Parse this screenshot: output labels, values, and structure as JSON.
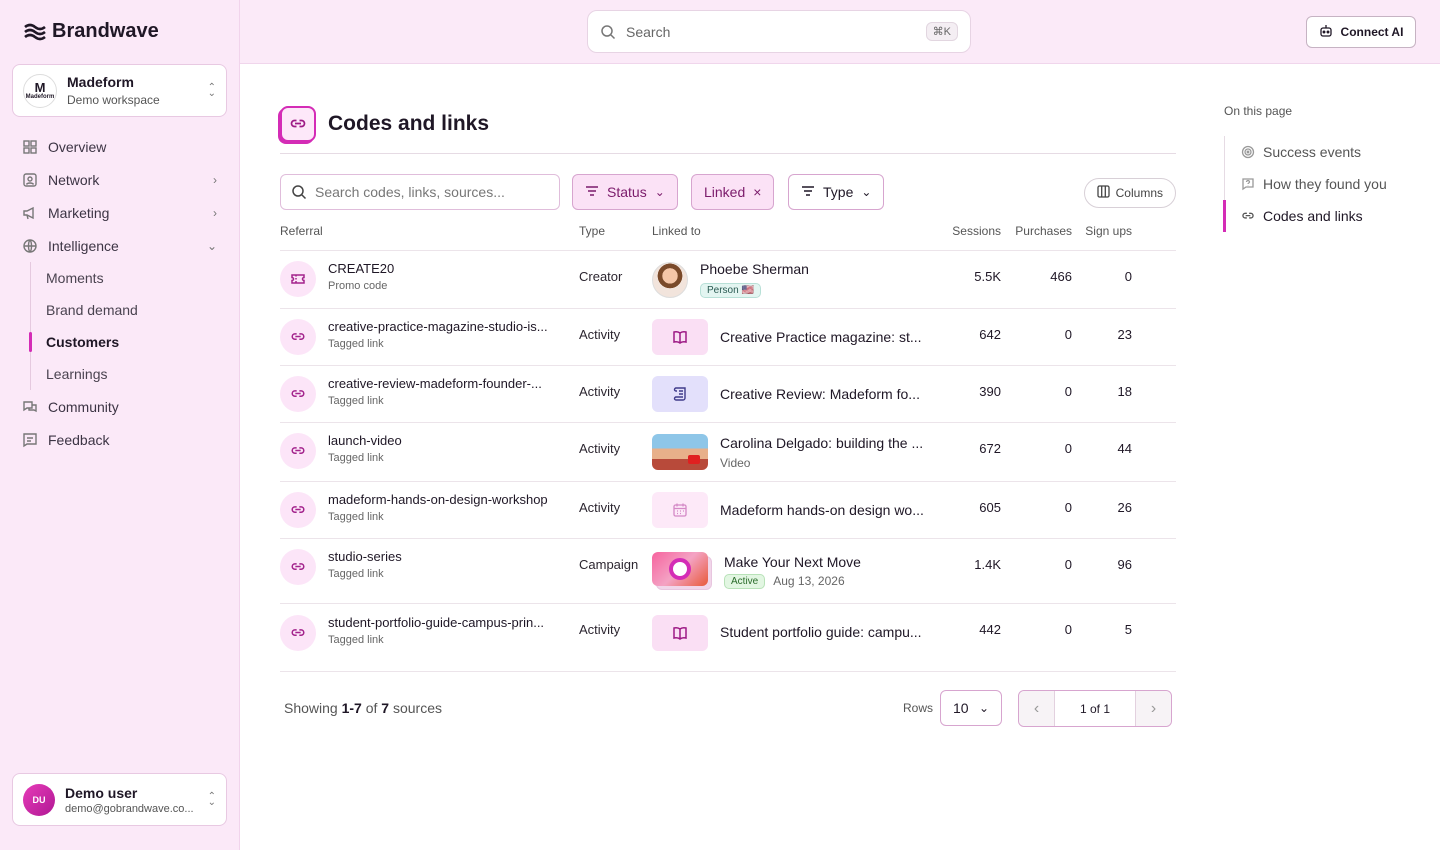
{
  "brand": {
    "name": "Brandwave"
  },
  "workspace": {
    "name": "Madeform",
    "sub": "Demo workspace",
    "logo_text": "Madeform"
  },
  "nav": {
    "overview": "Overview",
    "network": "Network",
    "marketing": "Marketing",
    "intelligence": "Intelligence",
    "sub": [
      "Moments",
      "Brand demand",
      "Customers",
      "Learnings"
    ],
    "community": "Community",
    "feedback": "Feedback"
  },
  "user": {
    "initials": "DU",
    "name": "Demo user",
    "email": "demo@gobrandwave.co..."
  },
  "topbar": {
    "search_placeholder": "Search",
    "shortcut": "⌘K",
    "connect_label": "Connect AI"
  },
  "page": {
    "title": "Codes and links"
  },
  "toolbar": {
    "search_placeholder": "Search codes, links, sources...",
    "status": "Status",
    "linked": "Linked",
    "type": "Type",
    "columns": "Columns"
  },
  "table": {
    "headers": {
      "referral": "Referral",
      "type": "Type",
      "linked_to": "Linked to",
      "sessions": "Sessions",
      "purchases": "Purchases",
      "signups": "Sign ups"
    },
    "rows": [
      {
        "name": "CREATE20",
        "sub": "Promo code",
        "type": "Creator",
        "linked": "Phoebe Sherman",
        "badge": "Person 🇺🇸",
        "sessions": "5.5K",
        "purchases": "466",
        "signups": "0"
      },
      {
        "name": "creative-practice-magazine-studio-is...",
        "sub": "Tagged link",
        "type": "Activity",
        "linked": "Creative Practice magazine: st...",
        "sessions": "642",
        "purchases": "0",
        "signups": "23"
      },
      {
        "name": "creative-review-madeform-founder-...",
        "sub": "Tagged link",
        "type": "Activity",
        "linked": "Creative Review: Madeform fo...",
        "sessions": "390",
        "purchases": "0",
        "signups": "18"
      },
      {
        "name": "launch-video",
        "sub": "Tagged link",
        "type": "Activity",
        "linked": "Carolina Delgado: building the ...",
        "linked_sub": "Video",
        "sessions": "672",
        "purchases": "0",
        "signups": "44"
      },
      {
        "name": "madeform-hands-on-design-workshop",
        "sub": "Tagged link",
        "type": "Activity",
        "linked": "Madeform hands-on design wo...",
        "sessions": "605",
        "purchases": "0",
        "signups": "26"
      },
      {
        "name": "studio-series",
        "sub": "Tagged link",
        "type": "Campaign",
        "linked": "Make Your Next Move",
        "badge": "Active",
        "date": "Aug 13, 2026",
        "sessions": "1.4K",
        "purchases": "0",
        "signups": "96"
      },
      {
        "name": "student-portfolio-guide-campus-prin...",
        "sub": "Tagged link",
        "type": "Activity",
        "linked": "Student portfolio guide: campu...",
        "sessions": "442",
        "purchases": "0",
        "signups": "5"
      }
    ]
  },
  "footer": {
    "showing_prefix": "Showing",
    "range": "1-7",
    "of": "of",
    "total": "7",
    "suffix": "sources",
    "rows_label": "Rows",
    "rows_value": "10",
    "page": "1 of 1"
  },
  "on_this_page": {
    "title": "On this page",
    "items": [
      "Success events",
      "How they found you",
      "Codes and links"
    ]
  },
  "colors": {
    "accent": "#d42cb6",
    "sidebar_bg": "#fbe9f8"
  }
}
